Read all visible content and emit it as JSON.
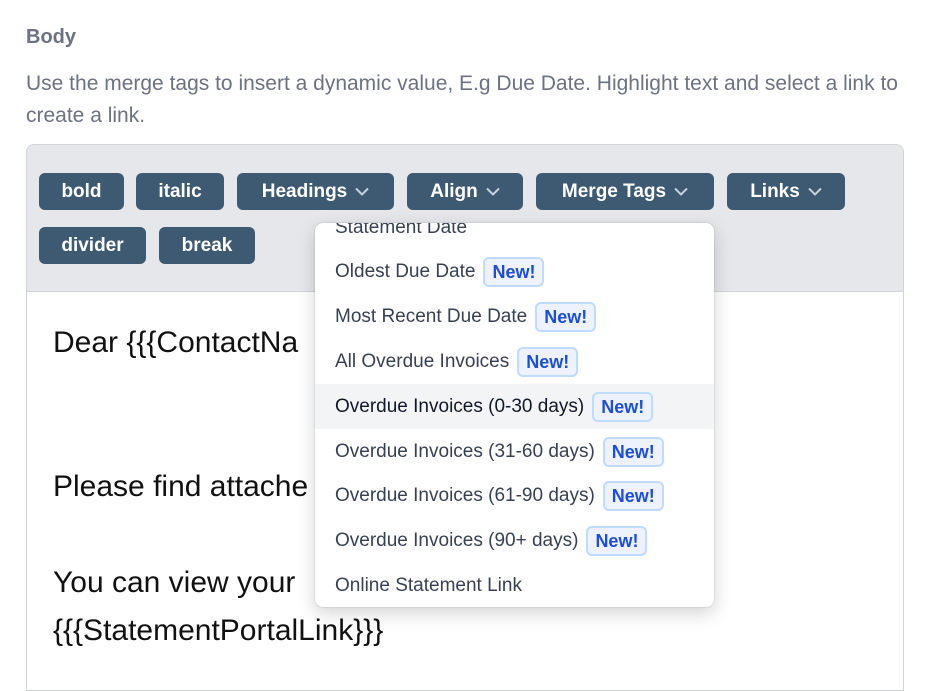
{
  "field": {
    "label": "Body",
    "help": "Use the merge tags to insert a dynamic value, E.g Due Date. Highlight text and select a link to create a link."
  },
  "toolbar": {
    "bold": "bold",
    "italic": "italic",
    "headings": "Headings",
    "align": "Align",
    "merge_tags": "Merge Tags",
    "links": "Links",
    "divider": "divider",
    "break": "break"
  },
  "editor": {
    "line1": "Dear {{{ContactNa",
    "line2": "Please find attache",
    "line3": "You can view your",
    "line4": "{{{StatementPortalLink}}}"
  },
  "merge_menu": {
    "items": [
      {
        "label": "Statement Date",
        "badge": ""
      },
      {
        "label": "Oldest Due Date",
        "badge": "New!"
      },
      {
        "label": "Most Recent Due Date",
        "badge": "New!"
      },
      {
        "label": "All Overdue Invoices",
        "badge": "New!"
      },
      {
        "label": "Overdue Invoices (0-30 days)",
        "badge": "New!"
      },
      {
        "label": "Overdue Invoices (31-60 days)",
        "badge": "New!"
      },
      {
        "label": "Overdue Invoices (61-90 days)",
        "badge": "New!"
      },
      {
        "label": "Overdue Invoices (90+ days)",
        "badge": "New!"
      },
      {
        "label": "Online Statement Link",
        "badge": ""
      }
    ],
    "highlighted_index": 4
  },
  "icons": {
    "chevron": "chevron-down-icon"
  }
}
